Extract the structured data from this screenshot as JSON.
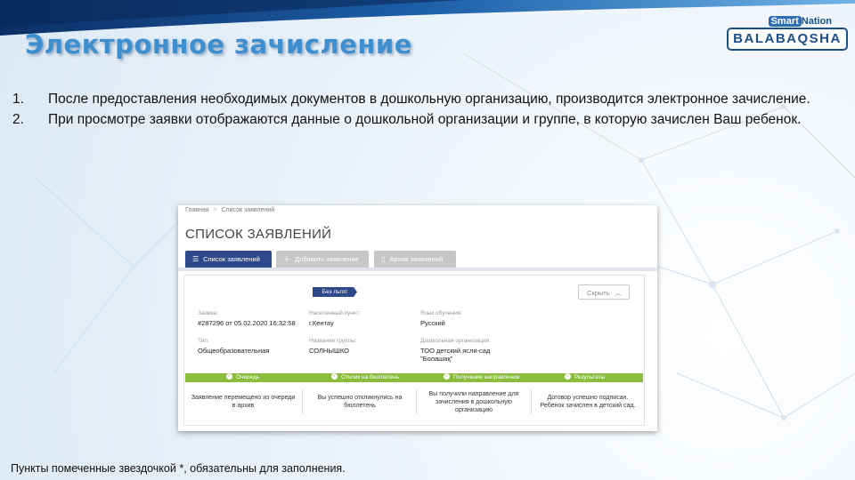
{
  "slide": {
    "title": "Электронное зачисление",
    "logo": {
      "brand_top": "Nation",
      "brand_smart": "Smart",
      "brand_main": "BALABAQSHA"
    },
    "items": [
      {
        "num": "1.",
        "text": "После предоставления  необходимых документов в дошкольную организацию, производится электронное  зачисление."
      },
      {
        "num": "2.",
        "text": "При просмотре заявки отображаются данные о дошкольной организации и группе, в которую зачислен Ваш ребенок."
      }
    ],
    "footnote": "Пункты  помеченные  звездочкой *, обязательны для заполнения."
  },
  "screenshot": {
    "breadcrumb": [
      "Главная",
      "Список заявлений"
    ],
    "page_title": "СПИСОК ЗАЯВЛЕНИЙ",
    "tabs": [
      {
        "label": "Список заявлений",
        "icon": "list-icon",
        "active": true
      },
      {
        "label": "Добавить заявление",
        "icon": "plus-icon",
        "active": false
      },
      {
        "label": "Архив заявлений",
        "icon": "document-icon",
        "active": false
      }
    ],
    "ribbon": "Без льгот",
    "hide_button": "Скрыть",
    "fields": {
      "application_label": "Заявка:",
      "application_value": "#287296 от 05.02.2020 16:32:58",
      "locality_label": "Населенный пункт:",
      "locality_value": "г.Кентау",
      "language_label": "Язык обучения:",
      "language_value": "Русский",
      "type_label": "Тип:",
      "type_value": "Общеобразовательная",
      "group_label": "Название группы:",
      "group_value": "СОЛНЫШКО",
      "org_label": "Дошкольная организация:",
      "org_value_1": "ТОО детский ясли-сад",
      "org_value_2": "\"Болашақ\""
    },
    "steps": [
      "Очередь",
      "Отклик на бюллетень",
      "Получение направления",
      "Результаты"
    ],
    "step_texts": [
      [
        "Заявление перемещено из очереди",
        "в архив"
      ],
      [
        "Вы успешно откликнулись на",
        "бюллетень"
      ],
      [
        "Вы получили направление для",
        "зачисления в дошкольную",
        "организацию"
      ],
      [
        "Договор успешно подписан.",
        "Ребёнок зачислен в детский сад."
      ]
    ],
    "colors": {
      "primary": "#2f4a8a",
      "progress": "#8bbd3c",
      "title": "#3d8fd0"
    }
  }
}
